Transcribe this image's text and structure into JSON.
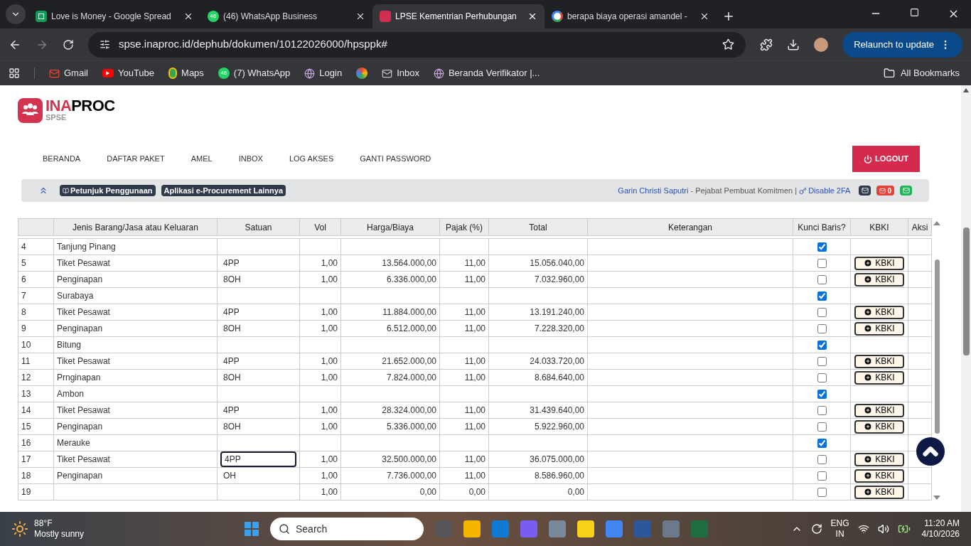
{
  "browser": {
    "tabs": [
      {
        "title": "Love is Money - Google Spread",
        "kind": "sheets",
        "selected": false
      },
      {
        "title": "(46) WhatsApp Business",
        "kind": "whatsapp",
        "badge": "46",
        "selected": false
      },
      {
        "title": "LPSE Kementrian Perhubungan",
        "kind": "inaproc",
        "selected": true
      },
      {
        "title": "berapa biaya operasi amandel -",
        "kind": "google",
        "selected": false
      }
    ],
    "url": "spse.inaproc.id/dephub/dokumen/10122026000/hpsppk#",
    "relaunch": "Relaunch to update",
    "bookmarks": [
      {
        "label": "Gmail",
        "kind": "gmail"
      },
      {
        "label": "YouTube",
        "kind": "youtube"
      },
      {
        "label": "Maps",
        "kind": "maps"
      },
      {
        "label": "(7) WhatsApp",
        "kind": "whatsapp",
        "badge": "46"
      },
      {
        "label": "Login",
        "kind": "globe"
      },
      {
        "kind": "photos"
      },
      {
        "label": "Inbox",
        "kind": "mail"
      },
      {
        "label": "Beranda Verifikator |...",
        "kind": "globe"
      }
    ],
    "all_bookmarks": "All Bookmarks"
  },
  "site": {
    "logo": {
      "brand_a": "INA",
      "brand_b": "PROC",
      "sub": "SPSE"
    },
    "nav": [
      "BERANDA",
      "DAFTAR PAKET",
      "AMEL",
      "INBOX",
      "LOG AKSES",
      "GANTI PASSWORD"
    ],
    "logout": "LOGOUT",
    "info_bar": {
      "guide": "Petunjuk Penggunaan",
      "apps": "Aplikasi e-Procurement Lainnya",
      "user": "Garin Christi Saputri",
      "role": " - Pejabat Pembuat Komitmen | ",
      "twofa": "Disable 2FA",
      "unread": "0"
    }
  },
  "table": {
    "columns": [
      "",
      "Jenis Barang/Jasa atau Keluaran",
      "Satuan",
      "Vol",
      "Harga/Biaya",
      "Pajak (%)",
      "Total",
      "Keterangan",
      "Kunci Baris?",
      "KBKI",
      "Aksi"
    ],
    "rows": [
      {
        "no": "4",
        "item": "Tanjung Pinang",
        "locked": true,
        "editing": false
      },
      {
        "no": "5",
        "item": "Tiket Pesawat",
        "unit": "4PP",
        "vol": "1,00",
        "price": "13.564.000,00",
        "tax": "11,00",
        "total": "15.056.040,00",
        "locked": false,
        "kbki": "KBKI",
        "editing": false
      },
      {
        "no": "6",
        "item": "Penginapan",
        "unit": "8OH",
        "vol": "1,00",
        "price": "6.336.000,00",
        "tax": "11,00",
        "total": "7.032.960,00",
        "locked": false,
        "kbki": "KBKI",
        "editing": false
      },
      {
        "no": "7",
        "item": "Surabaya",
        "locked": true,
        "editing": false
      },
      {
        "no": "8",
        "item": "Tiket Pesawat",
        "unit": "4PP",
        "vol": "1,00",
        "price": "11.884.000,00",
        "tax": "11,00",
        "total": "13.191.240,00",
        "locked": false,
        "kbki": "KBKI",
        "editing": false
      },
      {
        "no": "9",
        "item": "Penginapan",
        "unit": "8OH",
        "vol": "1,00",
        "price": "6.512.000,00",
        "tax": "11,00",
        "total": "7.228.320,00",
        "locked": false,
        "kbki": "KBKI",
        "editing": false
      },
      {
        "no": "10",
        "item": "Bitung",
        "locked": true,
        "editing": false
      },
      {
        "no": "11",
        "item": "Tiket Pesawat",
        "unit": "4PP",
        "vol": "1,00",
        "price": "21.652.000,00",
        "tax": "11,00",
        "total": "24.033.720,00",
        "locked": false,
        "kbki": "KBKI",
        "editing": false
      },
      {
        "no": "12",
        "item": "Prnginapan",
        "unit": "8OH",
        "vol": "1,00",
        "price": "7.824.000,00",
        "tax": "11,00",
        "total": "8.684.640,00",
        "locked": false,
        "kbki": "KBKI",
        "editing": false
      },
      {
        "no": "13",
        "item": "Ambon",
        "locked": true,
        "editing": false
      },
      {
        "no": "14",
        "item": "Tiket Pesawat",
        "unit": "4PP",
        "vol": "1,00",
        "price": "28.324.000,00",
        "tax": "11,00",
        "total": "31.439.640,00",
        "locked": false,
        "kbki": "KBKI",
        "editing": false
      },
      {
        "no": "15",
        "item": "Penginapan",
        "unit": "8OH",
        "vol": "1,00",
        "price": "5.336.000,00",
        "tax": "11,00",
        "total": "5.922.960,00",
        "locked": false,
        "kbki": "KBKI",
        "editing": false
      },
      {
        "no": "16",
        "item": "Merauke",
        "locked": true,
        "editing": false
      },
      {
        "no": "17",
        "item": "Tiket Pesawat",
        "unit": "4PP",
        "vol": "1,00",
        "price": "32.500.000,00",
        "tax": "11,00",
        "total": "36.075.000,00",
        "locked": false,
        "kbki": "KBKI",
        "editing": true
      },
      {
        "no": "18",
        "item": "Penginapan",
        "unit": "OH",
        "vol": "1,00",
        "price": "7.736.000,00",
        "tax": "11,00",
        "total": "8.586.960,00",
        "locked": false,
        "kbki": "KBKI",
        "editing": false
      },
      {
        "no": "19",
        "vol": "1,00",
        "price": "0,00",
        "tax": "0,00",
        "total": "0,00",
        "locked": false,
        "kbki": "KBKI",
        "editing": false
      }
    ]
  },
  "taskbar": {
    "temp": "88°F",
    "weather": "Mostly sunny",
    "search": "Search",
    "lang": "ENG",
    "region": "IN",
    "time": "11:20 AM",
    "date": "4/10/2026"
  }
}
